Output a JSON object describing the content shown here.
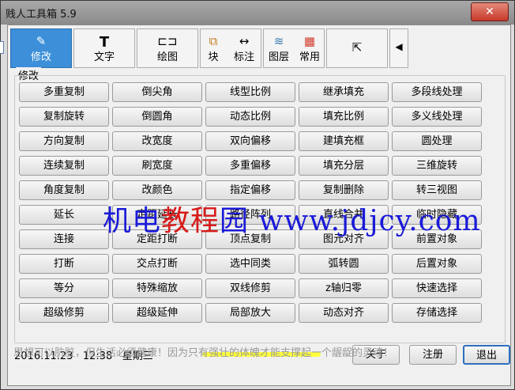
{
  "window": {
    "title": "贱人工具箱 5.9",
    "close_label": "✕"
  },
  "toolbar": {
    "modify": {
      "icon": "pencil-icon",
      "label": "修改"
    },
    "text": {
      "icon": "text-icon",
      "glyph": "T",
      "label": "文字"
    },
    "draw": {
      "icon": "draw-icon",
      "label": "绘图"
    },
    "block": {
      "icon": "block-icon",
      "label": "块"
    },
    "dim": {
      "icon": "dimension-icon",
      "label": "标注"
    },
    "layer": {
      "icon": "layer-icon",
      "label": "图层"
    },
    "common": {
      "icon": "common-icon",
      "label": "常用"
    },
    "expand": {
      "icon": "expand-icon"
    },
    "prev": {
      "icon": "left-arrow-icon",
      "glyph": "◀"
    },
    "checkbox_checked": true
  },
  "group": {
    "title": "修改",
    "rows": [
      [
        "多重复制",
        "倒尖角",
        "线型比例",
        "继承填充",
        "多段线处理"
      ],
      [
        "复制旋转",
        "倒圆角",
        "动态比例",
        "填充比例",
        "多义线处理"
      ],
      [
        "方向复制",
        "改宽度",
        "双向偏移",
        "建填充框",
        "圆处理"
      ],
      [
        "连续复制",
        "刷宽度",
        "多重偏移",
        "填充分层",
        "三维旋转"
      ],
      [
        "角度复制",
        "改颜色",
        "指定偏移",
        "复制删除",
        "转三视图"
      ],
      [
        "延长",
        "定距延长",
        "路径阵列",
        "直线合并",
        "临时隐藏"
      ],
      [
        "连接",
        "定距打断",
        "顶点复制",
        "图元对齐",
        "前置对象"
      ],
      [
        "打断",
        "交点打断",
        "选中同类",
        "弧转圆",
        "后置对象"
      ],
      [
        "等分",
        "特殊缩放",
        "双线修剪",
        "z轴归零",
        "快速选择"
      ],
      [
        "超级修剪",
        "超级延伸",
        "局部放大",
        "动态对齐",
        "存储选择"
      ]
    ]
  },
  "status": {
    "date": "2016.11.23",
    "time": "12:38",
    "weekday": "星期三"
  },
  "buttons": {
    "about": "关于",
    "register": "注册",
    "exit": "退出"
  },
  "motto": "思想可以肮脏，但生活必须健康！因为只有强壮的体魄才能支撑起一个龌龊的灵魂！",
  "watermark": {
    "left": "机电",
    "mid": "教程",
    "tail": "园",
    "url": "www.jdjcy.com"
  },
  "colors": {
    "active_tab": "#3c8fd8",
    "watermark_blue": "#1a1ad8",
    "watermark_red": "#d81a1a",
    "highlight": "#ffff3c"
  }
}
